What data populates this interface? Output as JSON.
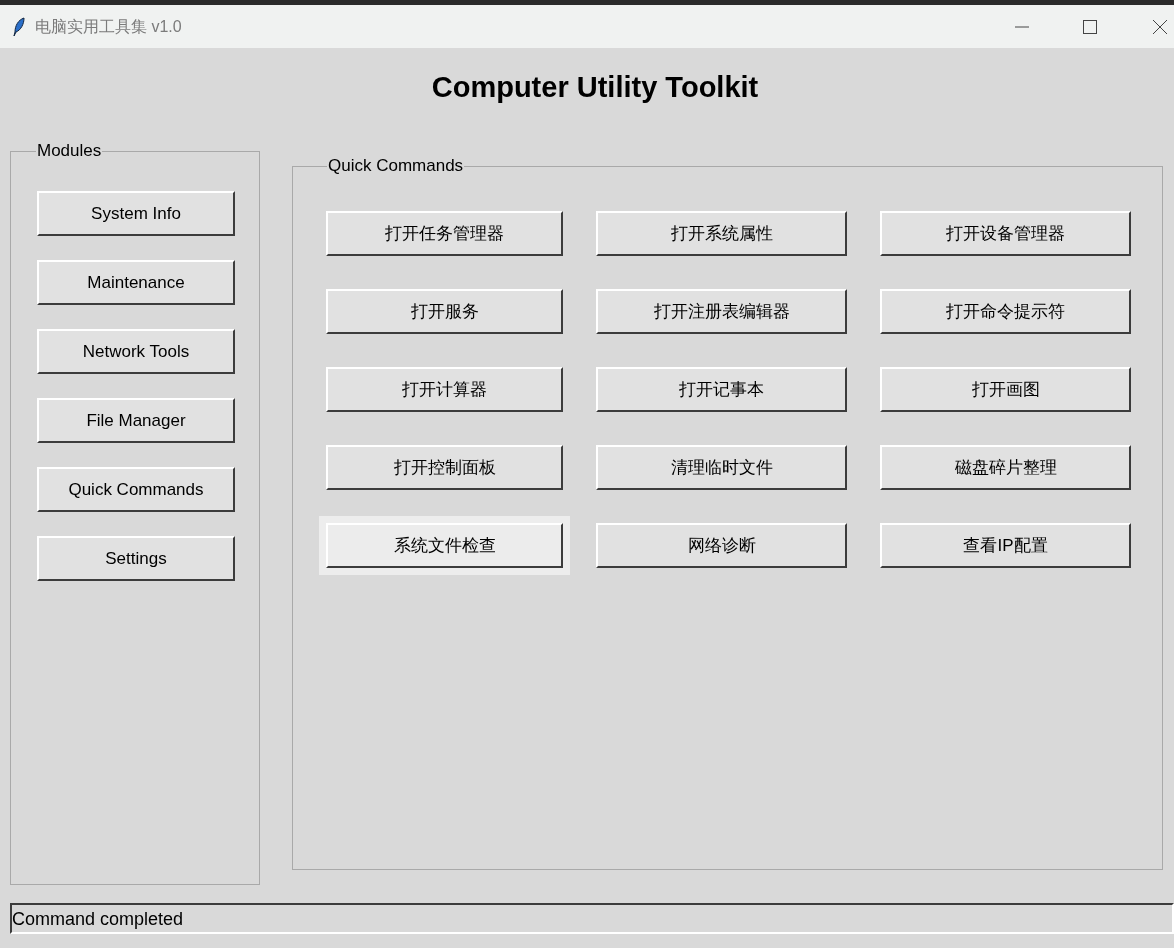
{
  "window": {
    "title": "电脑实用工具集 v1.0"
  },
  "heading": "Computer Utility Toolkit",
  "modules": {
    "label": "Modules",
    "items": [
      {
        "label": "System Info"
      },
      {
        "label": "Maintenance"
      },
      {
        "label": "Network Tools"
      },
      {
        "label": "File Manager"
      },
      {
        "label": "Quick Commands"
      },
      {
        "label": "Settings"
      }
    ]
  },
  "quick_commands": {
    "label": "Quick Commands",
    "buttons": [
      {
        "label": "打开任务管理器",
        "hovered": false
      },
      {
        "label": "打开系统属性",
        "hovered": false
      },
      {
        "label": "打开设备管理器",
        "hovered": false
      },
      {
        "label": "打开服务",
        "hovered": false
      },
      {
        "label": "打开注册表编辑器",
        "hovered": false
      },
      {
        "label": "打开命令提示符",
        "hovered": false
      },
      {
        "label": "打开计算器",
        "hovered": false
      },
      {
        "label": "打开记事本",
        "hovered": false
      },
      {
        "label": "打开画图",
        "hovered": false
      },
      {
        "label": "打开控制面板",
        "hovered": false
      },
      {
        "label": "清理临时文件",
        "hovered": false
      },
      {
        "label": "磁盘碎片整理",
        "hovered": false
      },
      {
        "label": "系统文件检查",
        "hovered": true
      },
      {
        "label": "网络诊断",
        "hovered": false
      },
      {
        "label": "查看IP配置",
        "hovered": false
      }
    ]
  },
  "status_bar": "Command completed"
}
